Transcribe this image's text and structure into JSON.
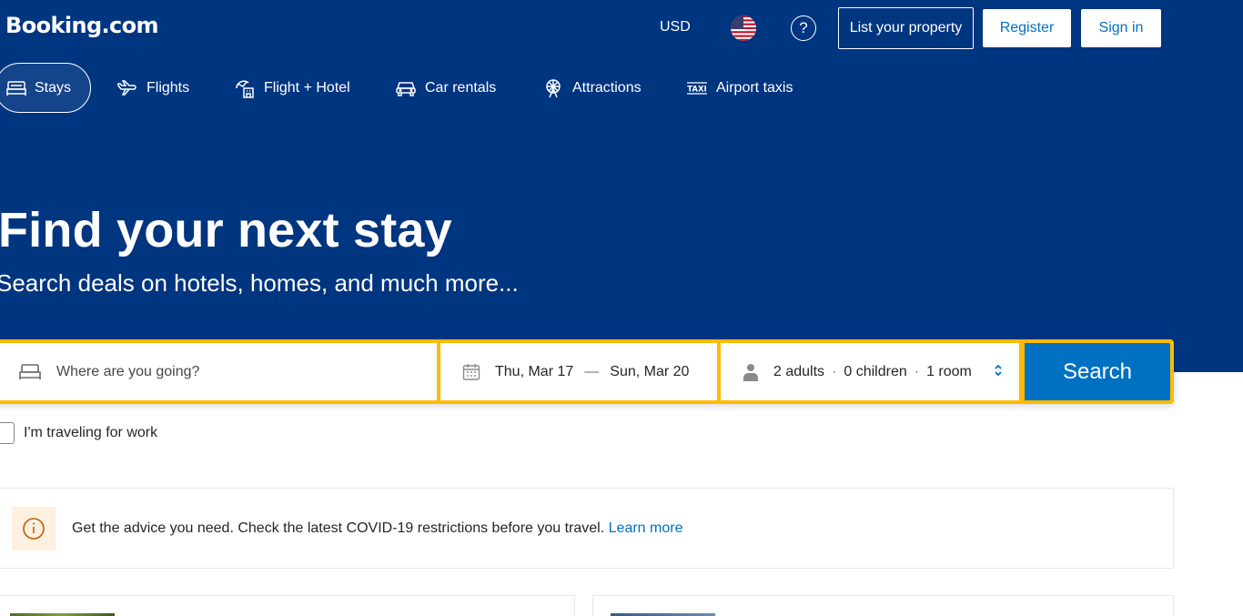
{
  "header": {
    "logo": "Booking.com",
    "currency": "USD",
    "flag_icon": "us-flag-icon",
    "help": "?",
    "list_property": "List your property",
    "register": "Register",
    "sign_in": "Sign in"
  },
  "nav": {
    "items": [
      {
        "label": "Stays",
        "icon": "bed-icon",
        "active": true
      },
      {
        "label": "Flights",
        "icon": "plane-icon"
      },
      {
        "label": "Flight + Hotel",
        "icon": "plane-hotel-icon"
      },
      {
        "label": "Car rentals",
        "icon": "car-icon"
      },
      {
        "label": "Attractions",
        "icon": "ferris-wheel-icon"
      },
      {
        "label": "Airport taxis",
        "icon": "taxi-icon"
      }
    ]
  },
  "hero": {
    "title": "Find your next stay",
    "subtitle": "Search deals on hotels, homes, and much more..."
  },
  "search": {
    "destination_placeholder": "Where are you going?",
    "checkin": "Thu, Mar 17",
    "date_separator": "—",
    "checkout": "Sun, Mar 20",
    "adults": "2 adults",
    "children": "0 children",
    "rooms": "1 room",
    "separator": "·",
    "button": "Search"
  },
  "work_travel": {
    "label": "I'm traveling for work",
    "checked": false
  },
  "notice": {
    "text": "Get the advice you need. Check the latest COVID-19 restrictions before you travel.",
    "link": "Learn more"
  },
  "colors": {
    "brand_blue": "#003580",
    "accent_yellow": "#febb02",
    "link_blue": "#0071c2"
  }
}
